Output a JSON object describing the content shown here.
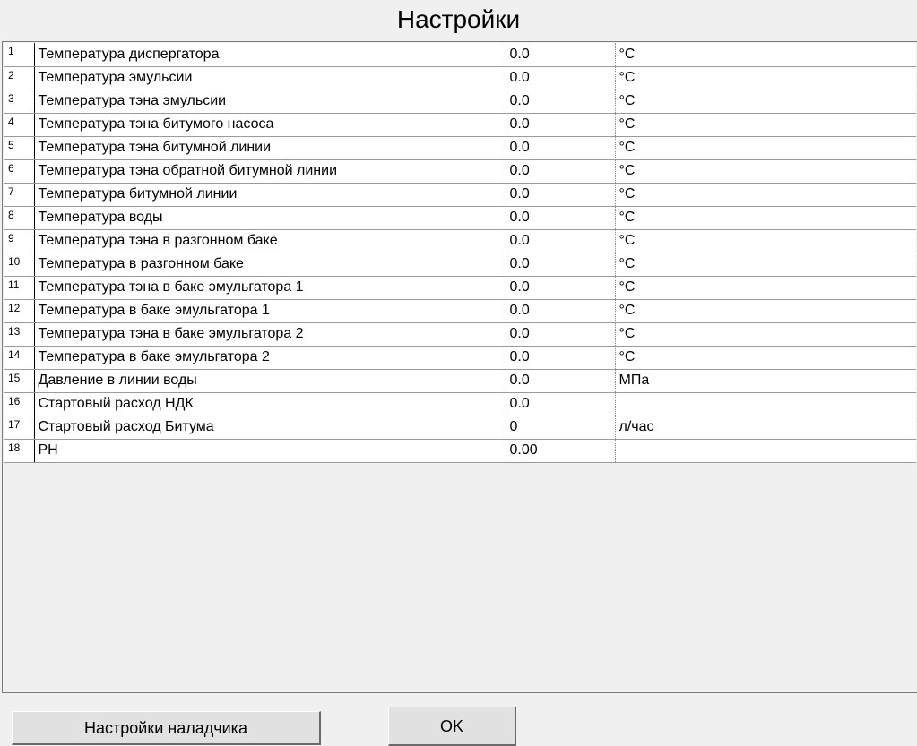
{
  "window": {
    "title": "Настройки"
  },
  "settings": [
    {
      "num": "1",
      "name": "Температура диспергатора",
      "value": "0.0",
      "unit": "°C"
    },
    {
      "num": "2",
      "name": "Температура эмульсии",
      "value": "0.0",
      "unit": "°C"
    },
    {
      "num": "3",
      "name": "Температура тэна эмульсии",
      "value": "0.0",
      "unit": "°C"
    },
    {
      "num": "4",
      "name": "Температура тэна битумого насоса",
      "value": "0.0",
      "unit": "°C"
    },
    {
      "num": "5",
      "name": "Температура тэна битумной линии",
      "value": "0.0",
      "unit": "°C"
    },
    {
      "num": "6",
      "name": "Температура тэна обратной битумной линии",
      "value": "0.0",
      "unit": "°C"
    },
    {
      "num": "7",
      "name": "Температура битумной линии",
      "value": "0.0",
      "unit": "°C"
    },
    {
      "num": "8",
      "name": "Температура воды",
      "value": "0.0",
      "unit": "°C"
    },
    {
      "num": "9",
      "name": "Температура тэна в разгонном баке",
      "value": "0.0",
      "unit": "°C"
    },
    {
      "num": "10",
      "name": "Температура в разгонном баке",
      "value": "0.0",
      "unit": "°C"
    },
    {
      "num": "11",
      "name": "Температура тэна в баке эмульгатора 1",
      "value": "0.0",
      "unit": "°C"
    },
    {
      "num": "12",
      "name": "Температура в баке эмульгатора 1",
      "value": "0.0",
      "unit": "°C"
    },
    {
      "num": "13",
      "name": "Температура тэна в баке эмульгатора 2",
      "value": "0.0",
      "unit": "°C"
    },
    {
      "num": "14",
      "name": "Температура в баке эмульгатора 2",
      "value": "0.0",
      "unit": "°C"
    },
    {
      "num": "15",
      "name": "Давление в линии воды",
      "value": "0.0",
      "unit": "МПа"
    },
    {
      "num": "16",
      "name": "Стартовый расход НДК",
      "value": "0.0",
      "unit": ""
    },
    {
      "num": "17",
      "name": "Стартовый расход Битума",
      "value": "0",
      "unit": "л/час"
    },
    {
      "num": "18",
      "name": "PH",
      "value": "0.00",
      "unit": ""
    }
  ],
  "buttons": {
    "adjuster_label": "Настройки наладчика",
    "ok_label": "OK"
  },
  "colors": {
    "background": "#f0f0f0",
    "cell_background": "#ffffff",
    "button_face": "#e1e1e1"
  }
}
